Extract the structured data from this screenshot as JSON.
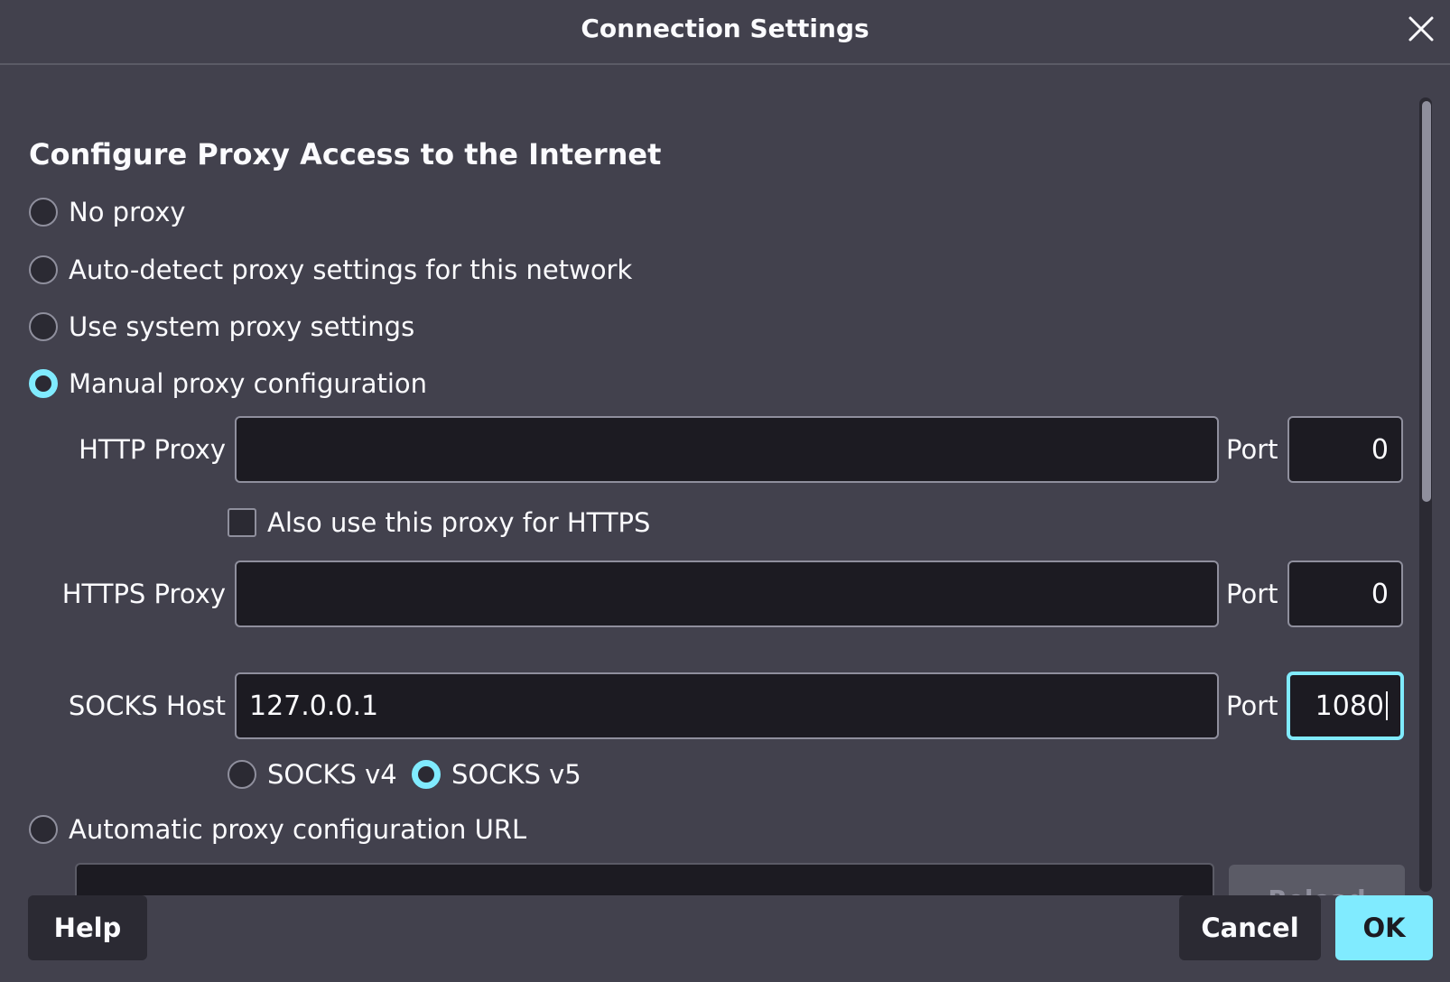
{
  "dialog": {
    "title": "Connection Settings"
  },
  "heading": "Configure Proxy Access to the Internet",
  "proxy_options": {
    "no_proxy": "No proxy",
    "auto_detect": "Auto-detect proxy settings for this network",
    "system": "Use system proxy settings",
    "manual": "Manual proxy configuration",
    "auto_url": "Automatic proxy configuration URL",
    "selected": "manual"
  },
  "http": {
    "label": "HTTP Proxy",
    "value": "",
    "port_label": "Port",
    "port_value": "0"
  },
  "also_https": {
    "label": "Also use this proxy for HTTPS",
    "checked": false
  },
  "https": {
    "label": "HTTPS Proxy",
    "value": "",
    "port_label": "Port",
    "port_value": "0"
  },
  "socks": {
    "label": "SOCKS Host",
    "value": "127.0.0.1",
    "port_label": "Port",
    "port_value": "1080",
    "v4_label": "SOCKS v4",
    "v5_label": "SOCKS v5",
    "version_selected": "v5"
  },
  "reload_label": "Reload",
  "footer": {
    "help": "Help",
    "cancel": "Cancel",
    "ok": "OK"
  },
  "colors": {
    "accent": "#80ebff",
    "background": "#42414d",
    "field": "#1c1b22"
  }
}
